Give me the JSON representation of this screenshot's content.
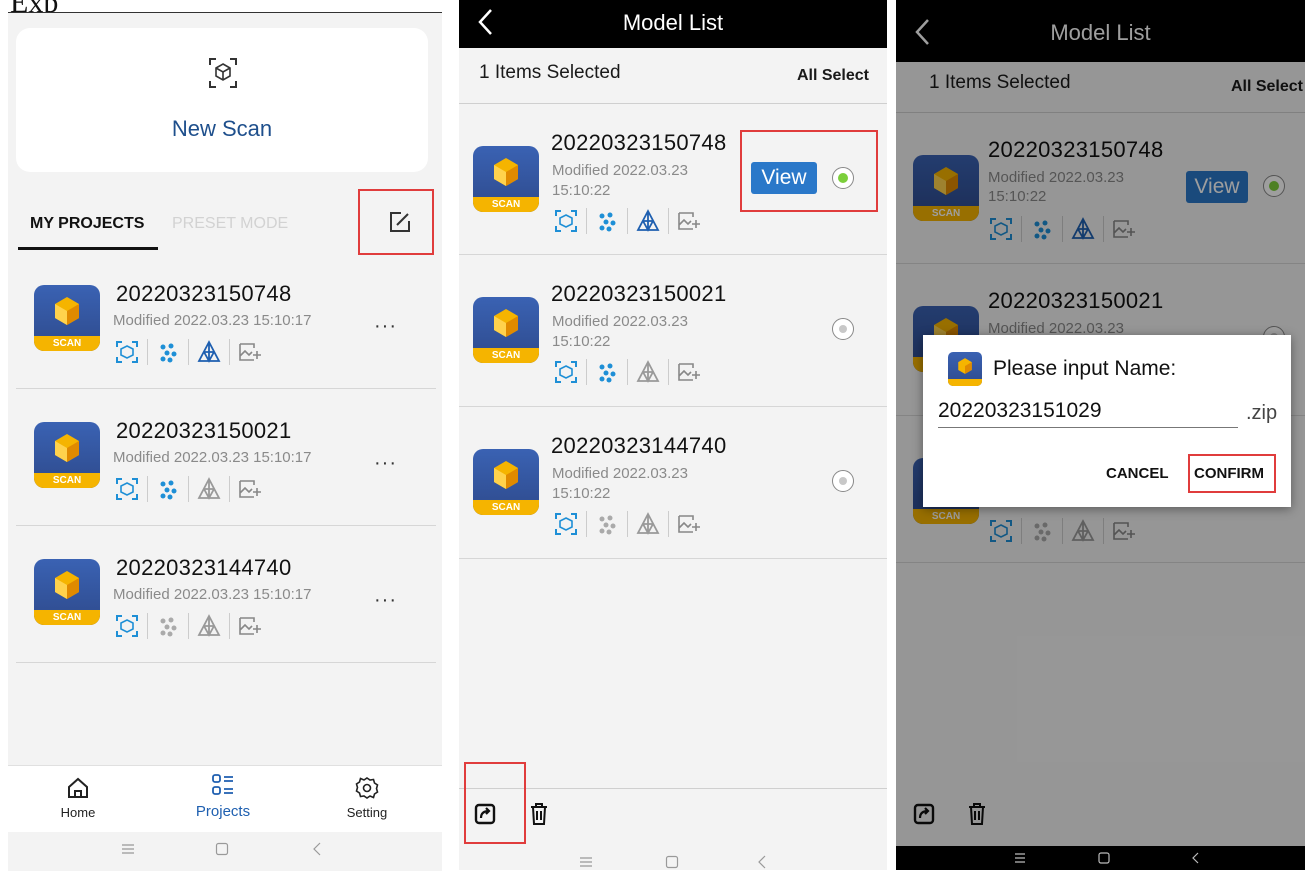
{
  "caption_fragment": "Exp",
  "panel1": {
    "new_scan_label": "New Scan",
    "tabs": [
      {
        "label": "MY PROJECTS"
      },
      {
        "label": "PRESET MODE"
      }
    ],
    "projects": [
      {
        "name": "20220323150748",
        "modified": "Modified 2022.03.23 15:10:17",
        "more": "···"
      },
      {
        "name": "20220323150021",
        "modified": "Modified 2022.03.23 15:10:17",
        "more": "···"
      },
      {
        "name": "20220323144740",
        "modified": "Modified 2022.03.23 15:10:17",
        "more": "···"
      }
    ],
    "nav": [
      {
        "label": "Home"
      },
      {
        "label": "Projects"
      },
      {
        "label": "Setting"
      }
    ],
    "scan_badge": "SCAN"
  },
  "panel2": {
    "title": "Model List",
    "selected_text": "1 Items Selected",
    "all_select": "All Select",
    "view_label": "View",
    "models": [
      {
        "name": "20220323150748",
        "modified": "Modified 2022.03.23",
        "time": "15:10:22"
      },
      {
        "name": "20220323150021",
        "modified": "Modified 2022.03.23",
        "time": "15:10:22"
      },
      {
        "name": "20220323144740",
        "modified": "Modified 2022.03.23",
        "time": "15:10:22"
      }
    ]
  },
  "panel3": {
    "title": "Model List",
    "selected_text": "1 Items Selected",
    "all_select": "All Select",
    "view_label": "View",
    "models": [
      {
        "name": "20220323150748",
        "modified": "Modified 2022.03.23",
        "time": "15:10:22"
      },
      {
        "name": "20220323150021",
        "modified": "Modified 2022.03.23"
      }
    ],
    "dialog": {
      "title": "Please input Name:",
      "input_value": "20220323151029",
      "suffix": ".zip",
      "cancel": "CANCEL",
      "confirm": "CONFIRM"
    }
  },
  "colors": {
    "accent_blue": "#2a78c9",
    "highlight_red": "#e03c3c",
    "scan_yellow": "#f5b400",
    "selected_green": "#7ccf3b"
  }
}
